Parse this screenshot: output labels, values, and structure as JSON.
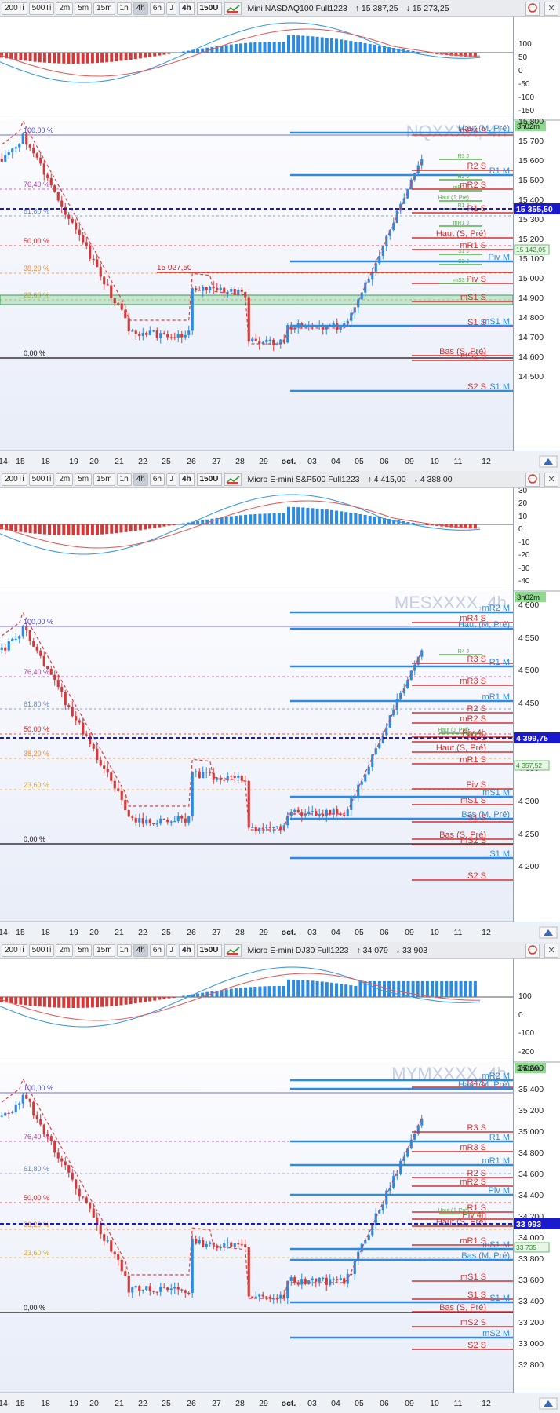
{
  "panels": [
    {
      "toolbar": {
        "btn_labels": [
          "200Ti",
          "500Ti",
          "2m",
          "5m",
          "15m",
          "1h",
          "4h",
          "6h",
          "J"
        ],
        "selected": "4h",
        "period": "4h",
        "units": "150U",
        "symbol": "Mini NASDAQ100 Full1223",
        "price_up": "↑ 15 387,25",
        "price_down": "↓ 15 273,25"
      },
      "watermark": "NQXXXX, 4h",
      "timer": "3h02m",
      "osc_ticks": [
        "100",
        "50",
        "0",
        "-50",
        "-100",
        "-150"
      ],
      "price_ticks": [
        "15 800",
        "15 700",
        "15 600",
        "15 500",
        "15 400",
        "15 300",
        "15 200",
        "15 100",
        "15 000",
        "14 900",
        "14 800",
        "14 700",
        "14 600",
        "14 500"
      ],
      "last_price": "15 355,50",
      "ma_price": "15 142,05",
      "fib": [
        "100,00 %",
        "76,40 %",
        "61,80 %",
        "50,00 %",
        "38,20 %",
        "23,60 %",
        "0,00 %"
      ],
      "mark": "15 027,50",
      "pivots": [
        "mR2 M",
        "R4 J",
        "Haut (M, Pré)",
        "mR4 S",
        "R3 J",
        "R2 S",
        "R1 M",
        "R2 J",
        "mR2 J",
        "mR2 S",
        "Haut (J, Pré)",
        "R1 J",
        "R1 S",
        "mR1 J",
        "Haut (S, Pré)",
        "mR1 S",
        "S1 J",
        "Piv M",
        "S2 J",
        "Piv S",
        "mS3 J",
        "mS1 S",
        "S1 S",
        "mS1 M",
        "Bas (S, Pré)",
        "mS2 S",
        "S2 S",
        "S1 M"
      ],
      "xticks": [
        "14",
        "15",
        "18",
        "19",
        "20",
        "21",
        "22",
        "25",
        "26",
        "27",
        "28",
        "29",
        "oct.",
        "03",
        "04",
        "05",
        "06",
        "09",
        "10",
        "11",
        "12"
      ]
    },
    {
      "toolbar": {
        "btn_labels": [
          "200Ti",
          "500Ti",
          "2m",
          "5m",
          "15m",
          "1h",
          "4h",
          "6h",
          "J"
        ],
        "selected": "4h",
        "period": "4h",
        "units": "150U",
        "symbol": "Micro E-mini S&P500 Full1223",
        "price_up": "↑ 4 415,00",
        "price_down": "↓ 4 388,00"
      },
      "watermark": "MESXXXX, 4h",
      "timer": "3h02m",
      "osc_ticks": [
        "30",
        "20",
        "10",
        "0",
        "-10",
        "-20",
        "-30",
        "-40"
      ],
      "price_ticks": [
        "4 600",
        "4 550",
        "4 500",
        "4 450",
        "4 400",
        "4 350",
        "4 300",
        "4 250",
        "4 200"
      ],
      "last_price": "4 399,75",
      "ma_price": "4 357,52",
      "fib": [
        "100,00 %",
        "76,40 %",
        "61,80 %",
        "50,00 %",
        "38,20 %",
        "23,60 %",
        "0,00 %"
      ],
      "mark": "",
      "pivots": [
        "mR2 M",
        "mR4 S",
        "Haut (M, Pré)",
        "R4 J",
        "R3 S",
        "R1 M",
        "mR3 S",
        "mR1 M",
        "R2 S",
        "mR2 S",
        "Haut (J, Pré)",
        "Piv 4h",
        "R1 S",
        "Haut (S, Pré)",
        "mR1 S",
        "Piv S",
        "mS1 S",
        "mS1 M",
        "Bas (M, Pré)",
        "S1 S",
        "Bas (S, Pré)",
        "mS2 S",
        "S1 M",
        "S2 S"
      ],
      "xticks": [
        "14",
        "15",
        "18",
        "19",
        "20",
        "21",
        "22",
        "25",
        "26",
        "27",
        "28",
        "29",
        "oct.",
        "03",
        "04",
        "05",
        "06",
        "09",
        "10",
        "11",
        "12"
      ]
    },
    {
      "toolbar": {
        "btn_labels": [
          "200Ti",
          "500Ti",
          "2m",
          "5m",
          "15m",
          "1h",
          "4h",
          "6h",
          "J"
        ],
        "selected": "4h",
        "period": "4h",
        "units": "150U",
        "symbol": "Micro E-mini DJ30 Full1223",
        "price_up": "↑ 34 079",
        "price_down": "↓ 33 903"
      },
      "watermark": "MYMXXXX, 4h",
      "timer": "3h02m",
      "osc_ticks": [
        "100",
        "0",
        "-100",
        "-200"
      ],
      "price_ticks": [
        "35 600",
        "35 400",
        "35 200",
        "35 000",
        "34 800",
        "34 600",
        "34 400",
        "34 200",
        "34 000",
        "33 800",
        "33 600",
        "33 400",
        "33 200",
        "33 000",
        "32 800"
      ],
      "last_price": "33 993",
      "ma_price": "33 735",
      "fib": [
        "100,00 %",
        "76,40 %",
        "61,80 %",
        "50,00 %",
        "38,20 %",
        "23,60 %",
        "0,00 %"
      ],
      "mark": "",
      "pivots": [
        "mR2 M",
        "R4 S",
        "Haut (M, Pré)",
        "R3 S",
        "R1 M",
        "mR3 S",
        "mR1 M",
        "R2 S",
        "mR2 S",
        "Piv M",
        "R1 S",
        "Haut (J, Pré)",
        "Piv 4h",
        "Haut (S, Pré)",
        "mS1 M",
        "mR1 S",
        "Bas (M, Pré)",
        "mS1 S",
        "S1 S",
        "S1 M",
        "Bas (S, Pré)",
        "mS2 S",
        "mS2 M",
        "S2 S"
      ],
      "xticks": [
        "14",
        "15",
        "18",
        "19",
        "20",
        "21",
        "22",
        "25",
        "26",
        "27",
        "28",
        "29",
        "oct.",
        "03",
        "04",
        "05",
        "06",
        "09",
        "10",
        "11",
        "12"
      ]
    }
  ]
}
